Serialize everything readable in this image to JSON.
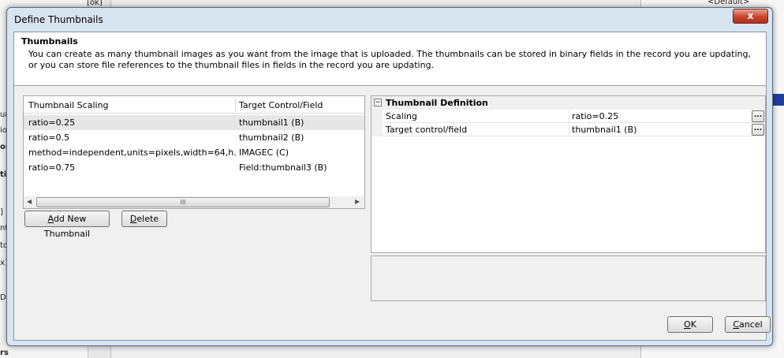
{
  "background": {
    "top_tab_fragment": "[ok]",
    "right_default": "<Default>",
    "left_fragments": [
      "ur",
      "io",
      "or",
      "ti",
      "]",
      "nt",
      "to",
      "x]",
      "Da",
      "rs"
    ]
  },
  "dialog": {
    "title": "Define Thumbnails",
    "close_glyph": "x",
    "header": {
      "title": "Thumbnails",
      "description": "You can create as many thumbnail images as you want from the image that is uploaded. The thumbnails can be stored in binary fields in the record you are updating, or you can store file references to the thumbnail files in fields in the record you are updating."
    },
    "grid": {
      "columns": [
        "Thumbnail Scaling",
        "Target Control/Field"
      ],
      "rows": [
        {
          "scaling": "ratio=0.25",
          "target": "thumbnail1 (B)"
        },
        {
          "scaling": "ratio=0.5",
          "target": "thumbnail2 (B)"
        },
        {
          "scaling": "method=independent,units=pixels,width=64,h...",
          "target": "IMAGEC (C)"
        },
        {
          "scaling": "ratio=0.75",
          "target": "Field:thumbnail3 (B)"
        }
      ],
      "scroll_thumb_glyph": "III",
      "scroll_left_glyph": "◀",
      "scroll_right_glyph": "▶"
    },
    "buttons": {
      "add_first": "A",
      "add_rest": "dd New Thumbnail",
      "delete_first": "D",
      "delete_rest": "elete",
      "ok_first": "O",
      "ok_rest": "K",
      "cancel_first": "C",
      "cancel_rest": "ancel"
    },
    "properties": {
      "category": "Thumbnail Definition",
      "toggle": "−",
      "items": [
        {
          "name": "Scaling",
          "value": "ratio=0.25",
          "button": "..."
        },
        {
          "name": "Target control/field",
          "value": "thumbnail1 (B)",
          "button": "..."
        }
      ]
    }
  }
}
